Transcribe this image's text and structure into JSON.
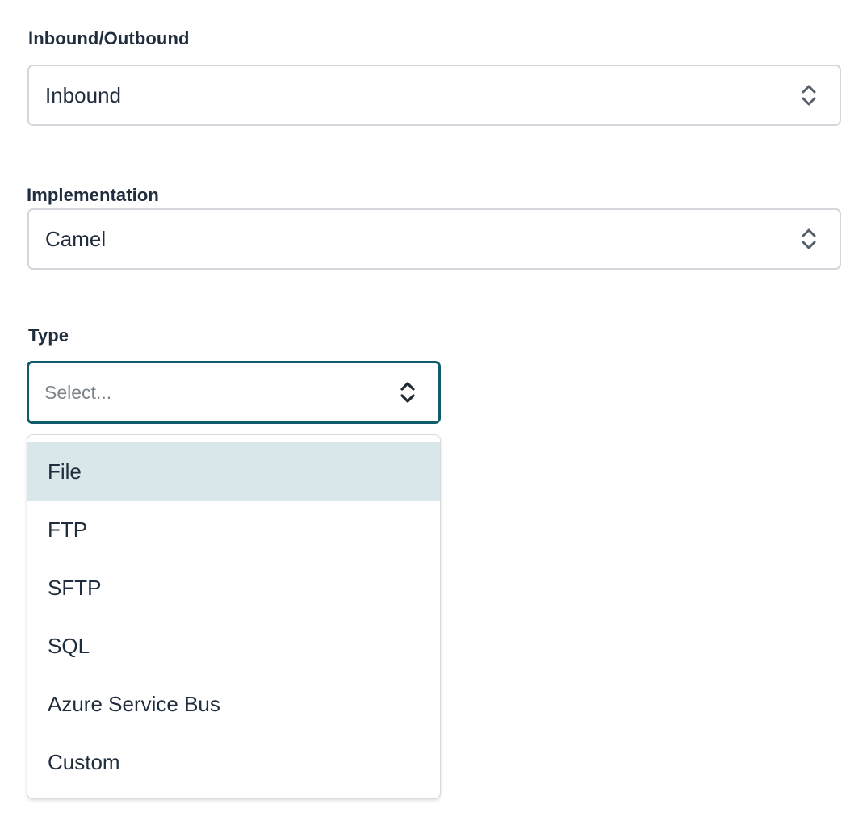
{
  "form": {
    "direction": {
      "label": "Inbound/Outbound",
      "value": "Inbound"
    },
    "implementation": {
      "label": "Implementation",
      "value": "Camel"
    },
    "type": {
      "label": "Type",
      "placeholder": "Select...",
      "options": [
        {
          "label": "File",
          "highlighted": true
        },
        {
          "label": "FTP",
          "highlighted": false
        },
        {
          "label": "SFTP",
          "highlighted": false
        },
        {
          "label": "SQL",
          "highlighted": false
        },
        {
          "label": "Azure Service Bus",
          "highlighted": false
        },
        {
          "label": "Custom",
          "highlighted": false
        }
      ]
    }
  },
  "icons": {
    "select_arrows": "chevron-up-down-icon"
  },
  "colors": {
    "focus_border": "#0f5d6b",
    "highlight_bg": "#d9e6ea",
    "text": "#1f2d3d",
    "placeholder": "#7d848c",
    "border": "#d3d7dc"
  }
}
